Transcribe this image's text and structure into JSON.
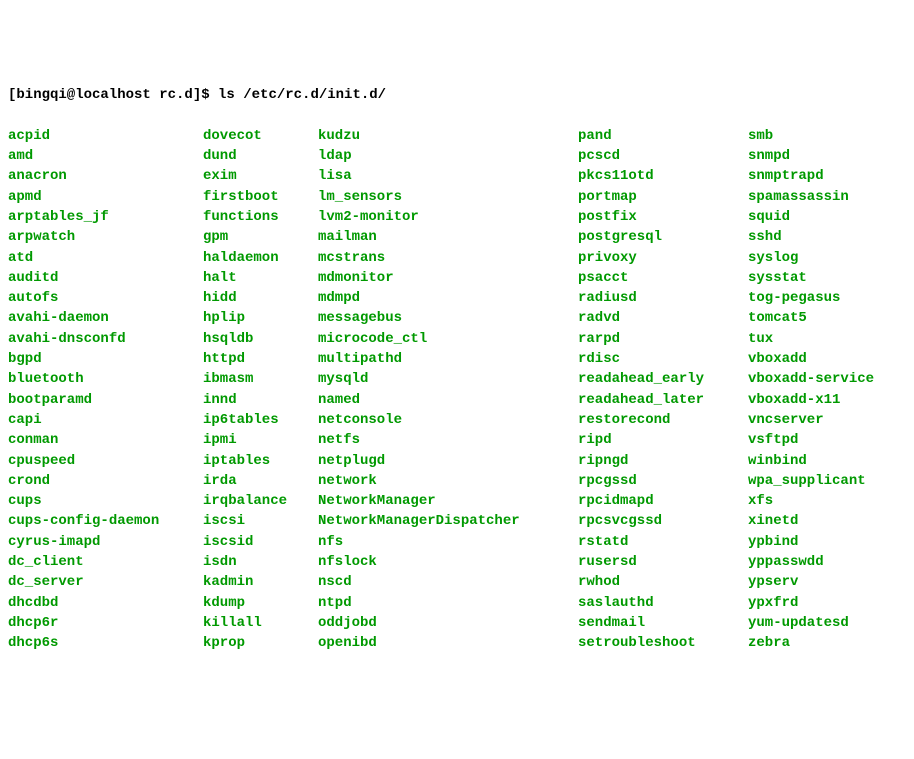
{
  "prompt": "[bingqi@localhost rc.d]$ ls /etc/rc.d/init.d/",
  "columns": [
    [
      "acpid",
      "amd",
      "anacron",
      "apmd",
      "arptables_jf",
      "arpwatch",
      "atd",
      "auditd",
      "autofs",
      "avahi-daemon",
      "avahi-dnsconfd",
      "bgpd",
      "bluetooth",
      "bootparamd",
      "capi",
      "conman",
      "cpuspeed",
      "crond",
      "cups",
      "cups-config-daemon",
      "cyrus-imapd",
      "dc_client",
      "dc_server",
      "dhcdbd",
      "dhcp6r",
      "dhcp6s"
    ],
    [
      "dovecot",
      "dund",
      "exim",
      "firstboot",
      "functions",
      "gpm",
      "haldaemon",
      "halt",
      "hidd",
      "hplip",
      "hsqldb",
      "httpd",
      "ibmasm",
      "innd",
      "ip6tables",
      "ipmi",
      "iptables",
      "irda",
      "irqbalance",
      "iscsi",
      "iscsid",
      "isdn",
      "kadmin",
      "kdump",
      "killall",
      "kprop"
    ],
    [
      "kudzu",
      "ldap",
      "lisa",
      "lm_sensors",
      "lvm2-monitor",
      "mailman",
      "mcstrans",
      "mdmonitor",
      "mdmpd",
      "messagebus",
      "microcode_ctl",
      "multipathd",
      "mysqld",
      "named",
      "netconsole",
      "netfs",
      "netplugd",
      "network",
      "NetworkManager",
      "NetworkManagerDispatcher",
      "nfs",
      "nfslock",
      "nscd",
      "ntpd",
      "oddjobd",
      "openibd"
    ],
    [
      "pand",
      "pcscd",
      "pkcs11otd",
      "portmap",
      "postfix",
      "postgresql",
      "privoxy",
      "psacct",
      "radiusd",
      "radvd",
      "rarpd",
      "rdisc",
      "readahead_early",
      "readahead_later",
      "restorecond",
      "ripd",
      "ripngd",
      "rpcgssd",
      "rpcidmapd",
      "rpcsvcgssd",
      "rstatd",
      "rusersd",
      "rwhod",
      "saslauthd",
      "sendmail",
      "setroubleshoot"
    ],
    [
      "smb",
      "snmpd",
      "snmptrapd",
      "spamassassin",
      "squid",
      "sshd",
      "syslog",
      "sysstat",
      "tog-pegasus",
      "tomcat5",
      "tux",
      "vboxadd",
      "vboxadd-service",
      "vboxadd-x11",
      "vncserver",
      "vsftpd",
      "winbind",
      "wpa_supplicant",
      "xfs",
      "xinetd",
      "ypbind",
      "yppasswdd",
      "ypserv",
      "ypxfrd",
      "yum-updatesd",
      "zebra"
    ]
  ]
}
